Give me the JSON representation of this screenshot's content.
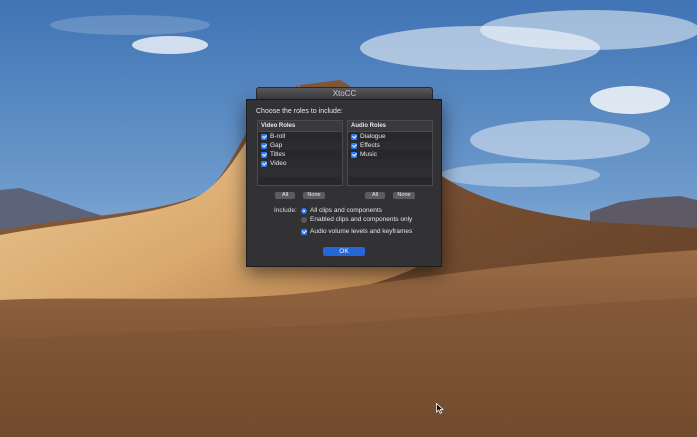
{
  "window": {
    "title": "XtoCC"
  },
  "dialog": {
    "prompt": "Choose the roles to include:",
    "video_roles": {
      "header": "Video Roles",
      "items": [
        {
          "label": "B-roll",
          "checked": true
        },
        {
          "label": "Gap",
          "checked": true
        },
        {
          "label": "Titles",
          "checked": true
        },
        {
          "label": "Video",
          "checked": true
        }
      ],
      "all_label": "All",
      "none_label": "None"
    },
    "audio_roles": {
      "header": "Audio Roles",
      "items": [
        {
          "label": "Dialogue",
          "checked": true
        },
        {
          "label": "Effects",
          "checked": true
        },
        {
          "label": "Music",
          "checked": true
        }
      ],
      "all_label": "All",
      "none_label": "None"
    },
    "include": {
      "label": "Include:",
      "option_all": "All clips and components",
      "option_enabled": "Enabled clips and components only",
      "selected": "option_all",
      "audio_checkbox_label": "Audio volume levels and keyframes",
      "audio_checked": true
    },
    "ok_label": "OK"
  },
  "colors": {
    "accent": "#2d7cf6",
    "ok_button": "#2566d8",
    "dialog_bg": "#323235"
  },
  "icons": {
    "cursor": "arrow-cursor-icon"
  }
}
